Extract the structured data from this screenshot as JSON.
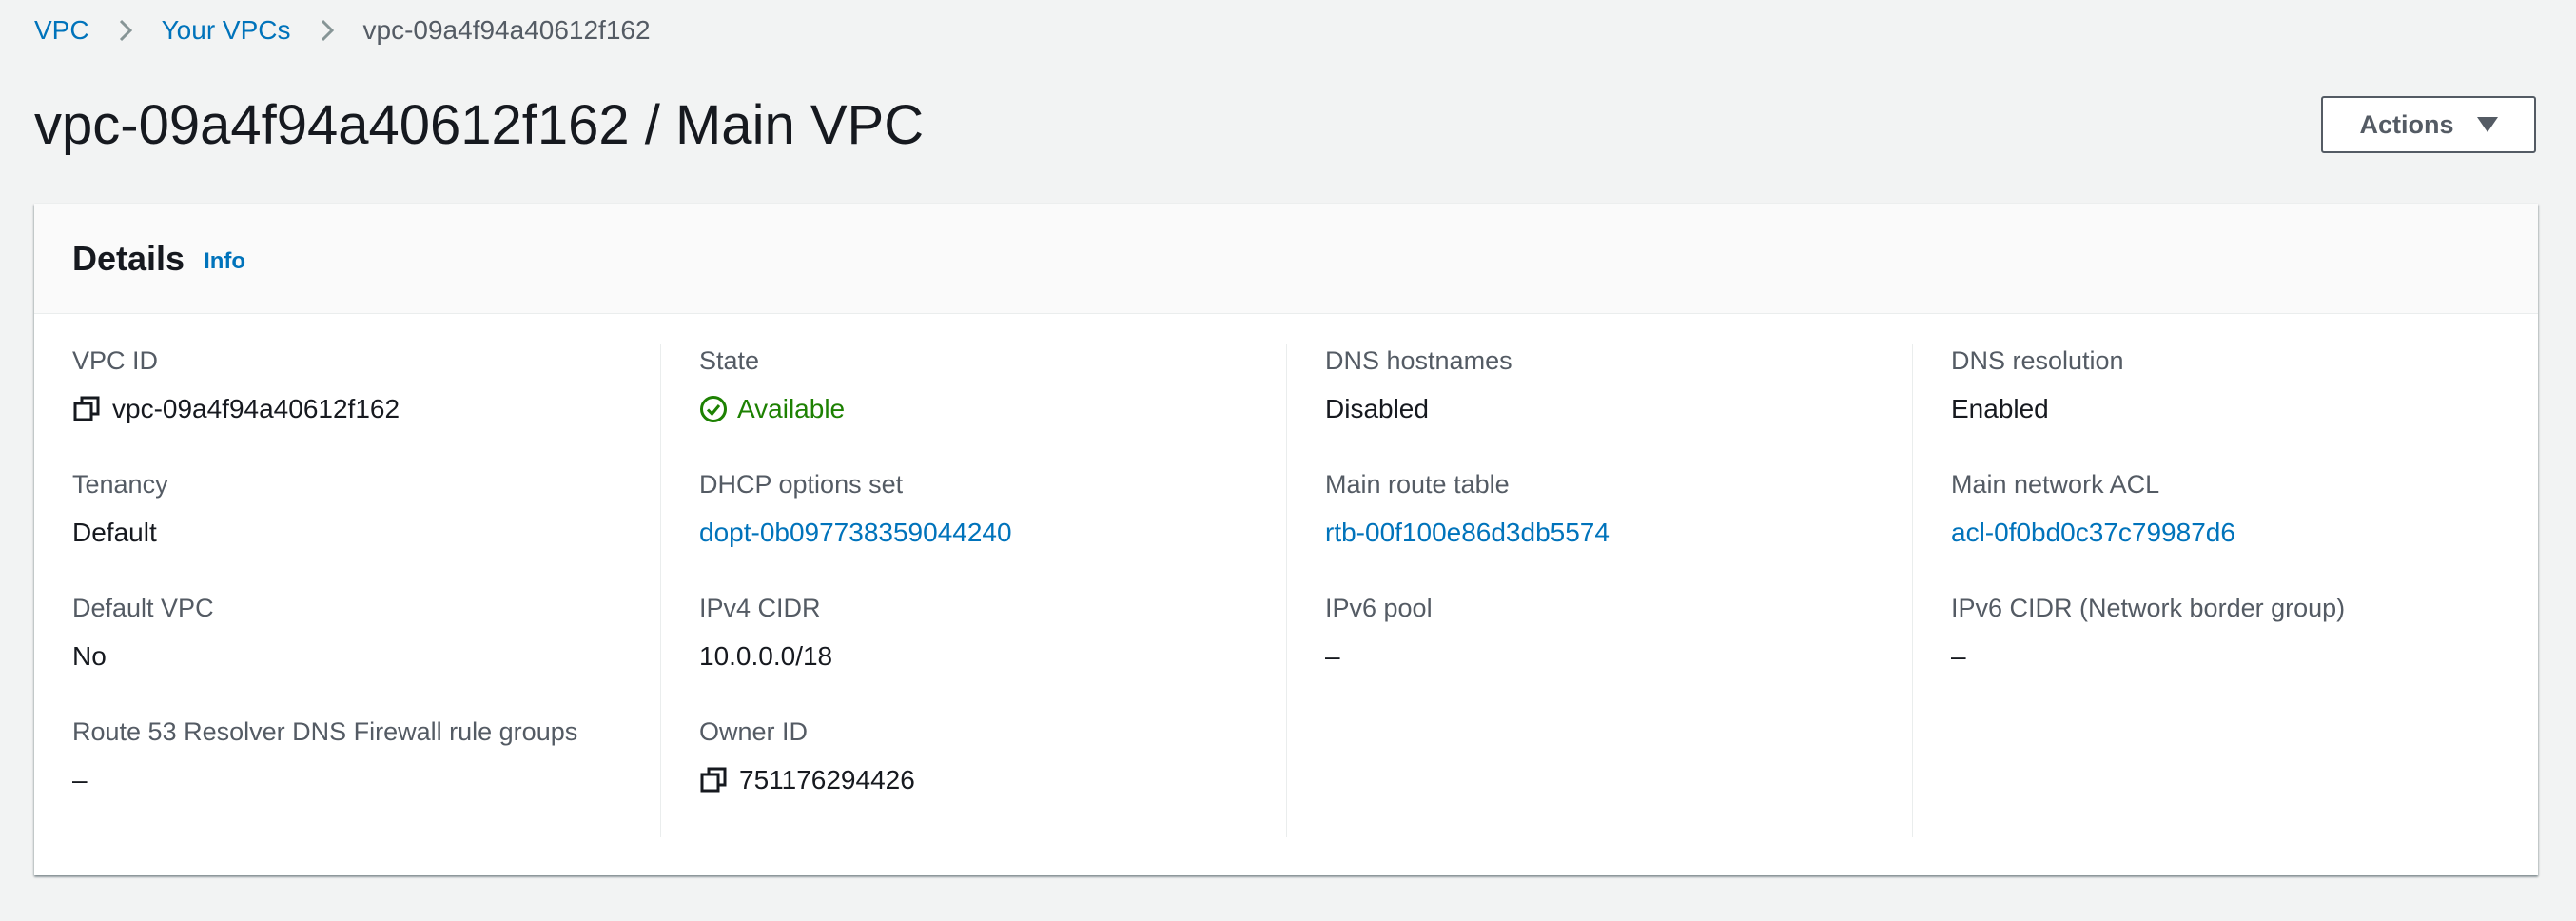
{
  "breadcrumb": {
    "items": [
      {
        "label": "VPC"
      },
      {
        "label": "Your VPCs"
      },
      {
        "label": "vpc-09a4f94a40612f162"
      }
    ]
  },
  "header": {
    "title": "vpc-09a4f94a40612f162 / Main VPC",
    "actions_label": "Actions"
  },
  "details": {
    "title": "Details",
    "info_label": "Info",
    "columns": [
      [
        {
          "label": "VPC ID",
          "value": "vpc-09a4f94a40612f162"
        },
        {
          "label": "Tenancy",
          "value": "Default"
        },
        {
          "label": "Default VPC",
          "value": "No"
        },
        {
          "label": "Route 53 Resolver DNS Firewall rule groups",
          "value": "–"
        }
      ],
      [
        {
          "label": "State",
          "value": "Available"
        },
        {
          "label": "DHCP options set",
          "value": "dopt-0b097738359044240"
        },
        {
          "label": "IPv4 CIDR",
          "value": "10.0.0.0/18"
        },
        {
          "label": "Owner ID",
          "value": "751176294426"
        }
      ],
      [
        {
          "label": "DNS hostnames",
          "value": "Disabled"
        },
        {
          "label": "Main route table",
          "value": "rtb-00f100e86d3db5574"
        },
        {
          "label": "IPv6 pool",
          "value": "–"
        }
      ],
      [
        {
          "label": "DNS resolution",
          "value": "Enabled"
        },
        {
          "label": "Main network ACL",
          "value": "acl-0f0bd0c37c79987d6"
        },
        {
          "label": "IPv6 CIDR (Network border group)",
          "value": "–"
        }
      ]
    ]
  },
  "icons": {
    "copy": "copy-icon",
    "status_available": "status-available-icon",
    "breadcrumb_separator": "chevron-right-icon",
    "actions_caret": "caret-down-icon"
  },
  "colors": {
    "link": "#0073bb",
    "status_success": "#1d8102",
    "text": "#16191f",
    "label": "#545b64",
    "background": "#f2f3f3"
  }
}
